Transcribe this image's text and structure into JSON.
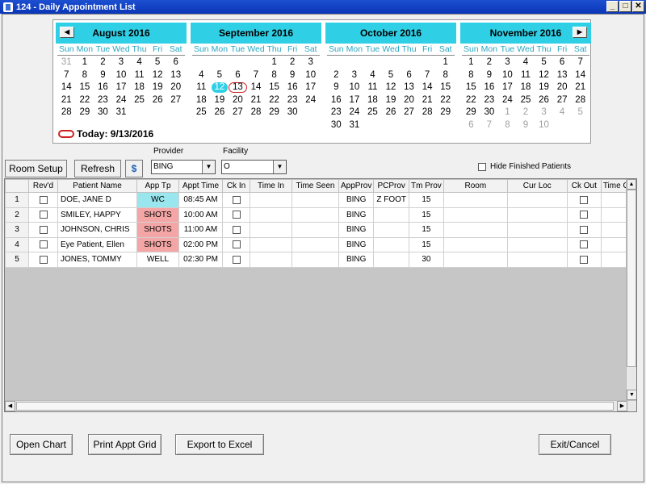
{
  "window": {
    "title": "124 - Daily Appointment List"
  },
  "calendar": {
    "dow": [
      "Sun",
      "Mon",
      "Tue",
      "Wed",
      "Thu",
      "Fri",
      "Sat"
    ],
    "months": [
      {
        "name": "August 2016",
        "days": [
          31,
          1,
          2,
          3,
          4,
          5,
          6,
          7,
          8,
          9,
          10,
          11,
          12,
          13,
          14,
          15,
          16,
          17,
          18,
          19,
          20,
          21,
          22,
          23,
          24,
          25,
          26,
          27,
          28,
          29,
          30,
          31
        ]
      },
      {
        "name": "September 2016",
        "days": [
          1,
          2,
          3,
          4,
          5,
          6,
          7,
          8,
          9,
          10,
          11,
          12,
          13,
          14,
          15,
          16,
          17,
          18,
          19,
          20,
          21,
          22,
          23,
          24,
          25,
          26,
          27,
          28,
          29,
          30
        ]
      },
      {
        "name": "October 2016",
        "days": [
          1,
          2,
          3,
          4,
          5,
          6,
          7,
          8,
          9,
          10,
          11,
          12,
          13,
          14,
          15,
          16,
          17,
          18,
          19,
          20,
          21,
          22,
          23,
          24,
          25,
          26,
          27,
          28,
          29,
          30,
          31
        ]
      },
      {
        "name": "November 2016",
        "days": [
          1,
          2,
          3,
          4,
          5,
          6,
          7,
          8,
          9,
          10,
          11,
          12,
          13,
          14,
          15,
          16,
          17,
          18,
          19,
          20,
          21,
          22,
          23,
          24,
          25,
          26,
          27,
          28,
          29,
          30,
          1,
          2,
          3,
          4,
          5,
          6,
          7,
          8,
          9,
          10
        ]
      }
    ],
    "today_label": "Today: 9/13/2016"
  },
  "toolbar": {
    "room_setup": "Room Setup",
    "refresh": "Refresh",
    "provider_label": "Provider",
    "provider_value": "BING",
    "facility_label": "Facility",
    "facility_value": "O",
    "hide_finished": "Hide Finished Patients"
  },
  "grid": {
    "columns": [
      "",
      "Rev'd",
      "Patient Name",
      "App Tp",
      "Appt Time",
      "Ck In",
      "Time In",
      "Time Seen",
      "AppProv",
      "PCProv",
      "Tm Prov",
      "Room",
      "Cur Loc",
      "Ck Out",
      "Time O"
    ],
    "rows": [
      {
        "n": "1",
        "name": "DOE, JANE D",
        "type": "WC",
        "time": "08:45 AM",
        "appprov": "BING",
        "pcprov": "Z FOOT",
        "tmprov": "15"
      },
      {
        "n": "2",
        "name": "SMILEY, HAPPY",
        "type": "SHOTS",
        "time": "10:00 AM",
        "appprov": "BING",
        "pcprov": "",
        "tmprov": "15"
      },
      {
        "n": "3",
        "name": "JOHNSON, CHRIS",
        "type": "SHOTS",
        "time": "11:00 AM",
        "appprov": "BING",
        "pcprov": "",
        "tmprov": "15"
      },
      {
        "n": "4",
        "name": "Eye Patient, Ellen",
        "type": "SHOTS",
        "time": "02:00 PM",
        "appprov": "BING",
        "pcprov": "",
        "tmprov": "15"
      },
      {
        "n": "5",
        "name": "JONES, TOMMY",
        "type": "WELL",
        "time": "02:30 PM",
        "appprov": "BING",
        "pcprov": "",
        "tmprov": "30"
      }
    ]
  },
  "footer": {
    "open_chart": "Open Chart",
    "print_grid": "Print Appt Grid",
    "export": "Export to Excel",
    "exit": "Exit/Cancel"
  }
}
